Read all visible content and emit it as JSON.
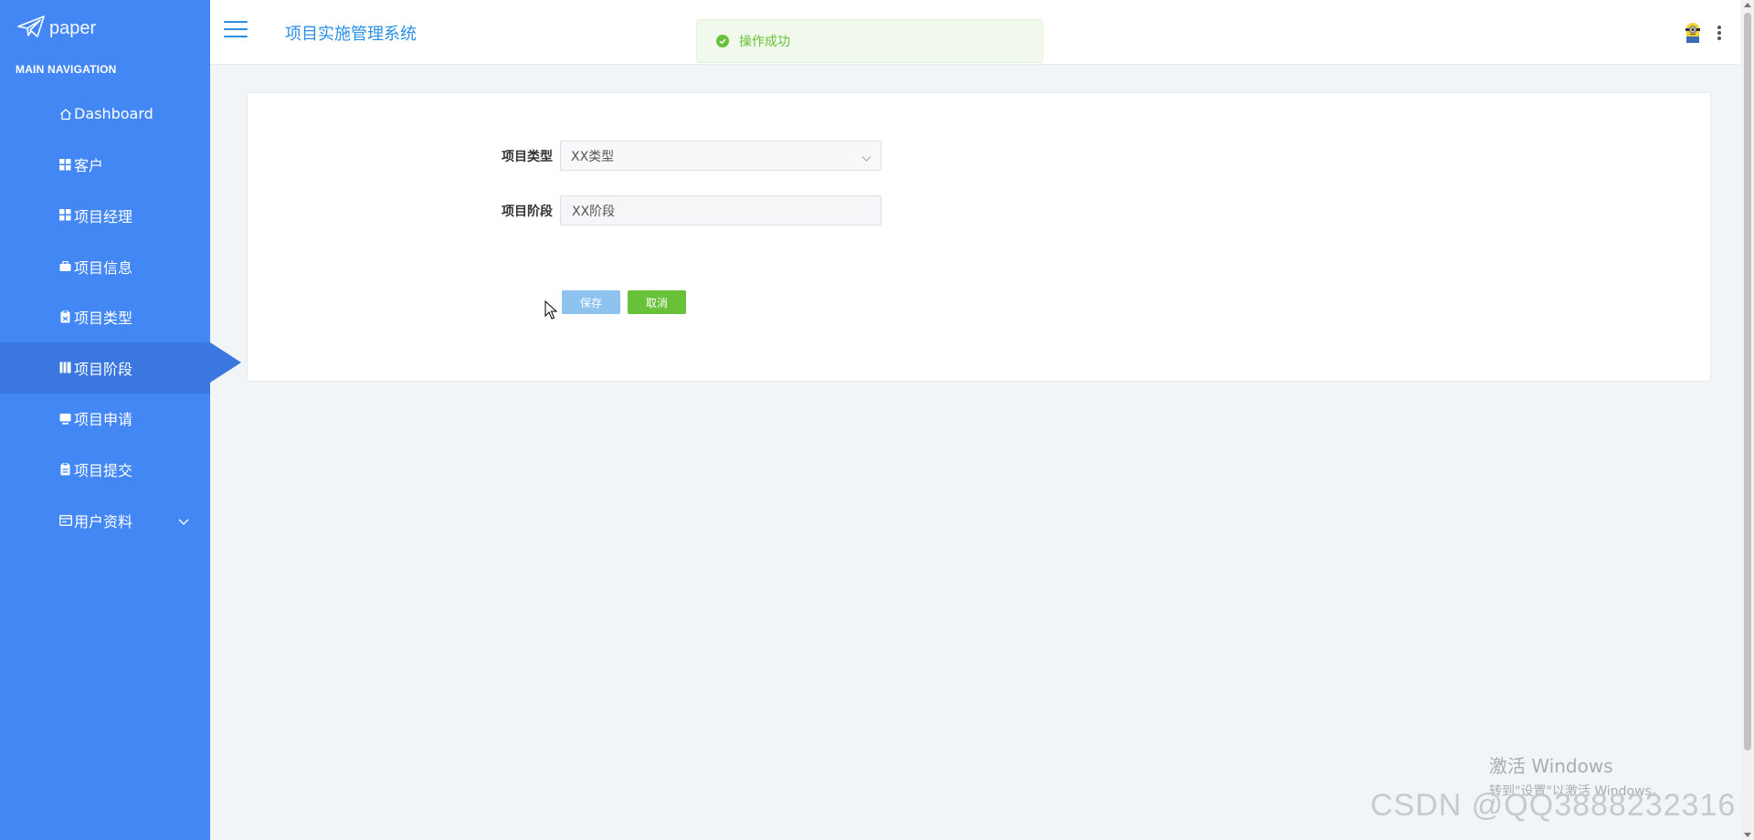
{
  "brand": {
    "logo_text": "paper",
    "icon": "paper-plane-icon"
  },
  "sidebar": {
    "header": "MAIN NAVIGATION",
    "items": [
      {
        "label": "Dashboard",
        "icon": "home-icon"
      },
      {
        "label": "客户",
        "icon": "grid-icon"
      },
      {
        "label": "项目经理",
        "icon": "grid-icon"
      },
      {
        "label": "项目信息",
        "icon": "briefcase-icon"
      },
      {
        "label": "项目类型",
        "icon": "clipboard-icon"
      },
      {
        "label": "项目阶段",
        "icon": "book-icon",
        "active": true
      },
      {
        "label": "项目申请",
        "icon": "monitor-icon"
      },
      {
        "label": "项目提交",
        "icon": "clipboard-icon"
      },
      {
        "label": "用户资料",
        "icon": "id-card-icon",
        "has_submenu": true
      }
    ]
  },
  "header": {
    "title": "项目实施管理系统"
  },
  "toast": {
    "message": "操作成功",
    "status_color": "#67c23a"
  },
  "form": {
    "type_label": "项目类型",
    "type_value": "XX类型",
    "stage_label": "项目阶段",
    "stage_value": "XX阶段",
    "save_label": "保存",
    "cancel_label": "取消"
  },
  "watermarks": {
    "windows_line1": "激活 Windows",
    "windows_line2": "转到\"设置\"以激活 Windows。",
    "csdn": "CSDN @QQ3888232316"
  },
  "colors": {
    "sidebar": "#4387f4",
    "accent": "#2b8fe6",
    "success": "#67c23a"
  }
}
